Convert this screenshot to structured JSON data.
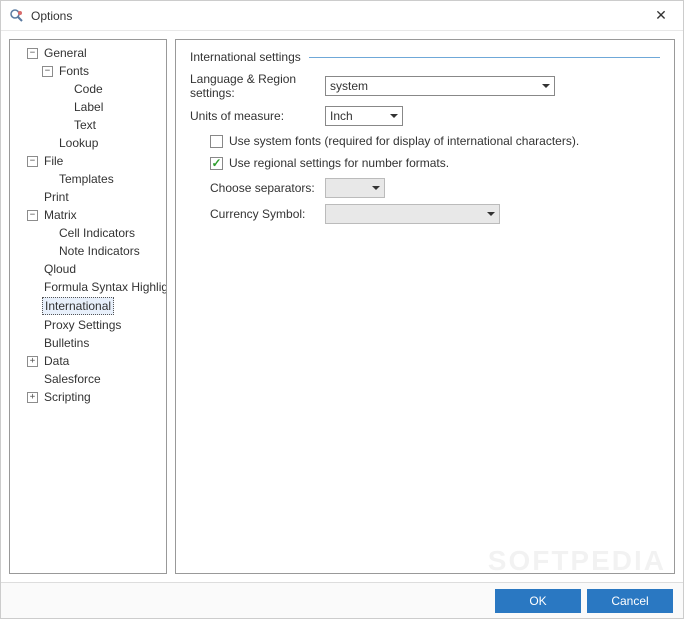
{
  "window": {
    "title": "Options"
  },
  "tree": {
    "general": "General",
    "fonts": "Fonts",
    "code": "Code",
    "label": "Label",
    "text": "Text",
    "lookup": "Lookup",
    "file": "File",
    "templates": "Templates",
    "print": "Print",
    "matrix": "Matrix",
    "cell_indicators": "Cell Indicators",
    "note_indicators": "Note Indicators",
    "qloud": "Qloud",
    "formula_syntax": "Formula Syntax Highlighting",
    "international": "International",
    "proxy": "Proxy Settings",
    "bulletins": "Bulletins",
    "data": "Data",
    "salesforce": "Salesforce",
    "scripting": "Scripting"
  },
  "panel": {
    "section_title": "International settings",
    "language_region_label": "Language & Region settings:",
    "language_region_value": "system",
    "units_label": "Units of measure:",
    "units_value": "Inch",
    "use_system_fonts": "Use system fonts (required for display of international characters).",
    "use_regional_settings": "Use regional settings for number formats.",
    "choose_separators_label": "Choose separators:",
    "choose_separators_value": "",
    "currency_symbol_label": "Currency Symbol:",
    "currency_symbol_value": ""
  },
  "footer": {
    "ok": "OK",
    "cancel": "Cancel"
  },
  "watermark": "SOFTPEDIA"
}
